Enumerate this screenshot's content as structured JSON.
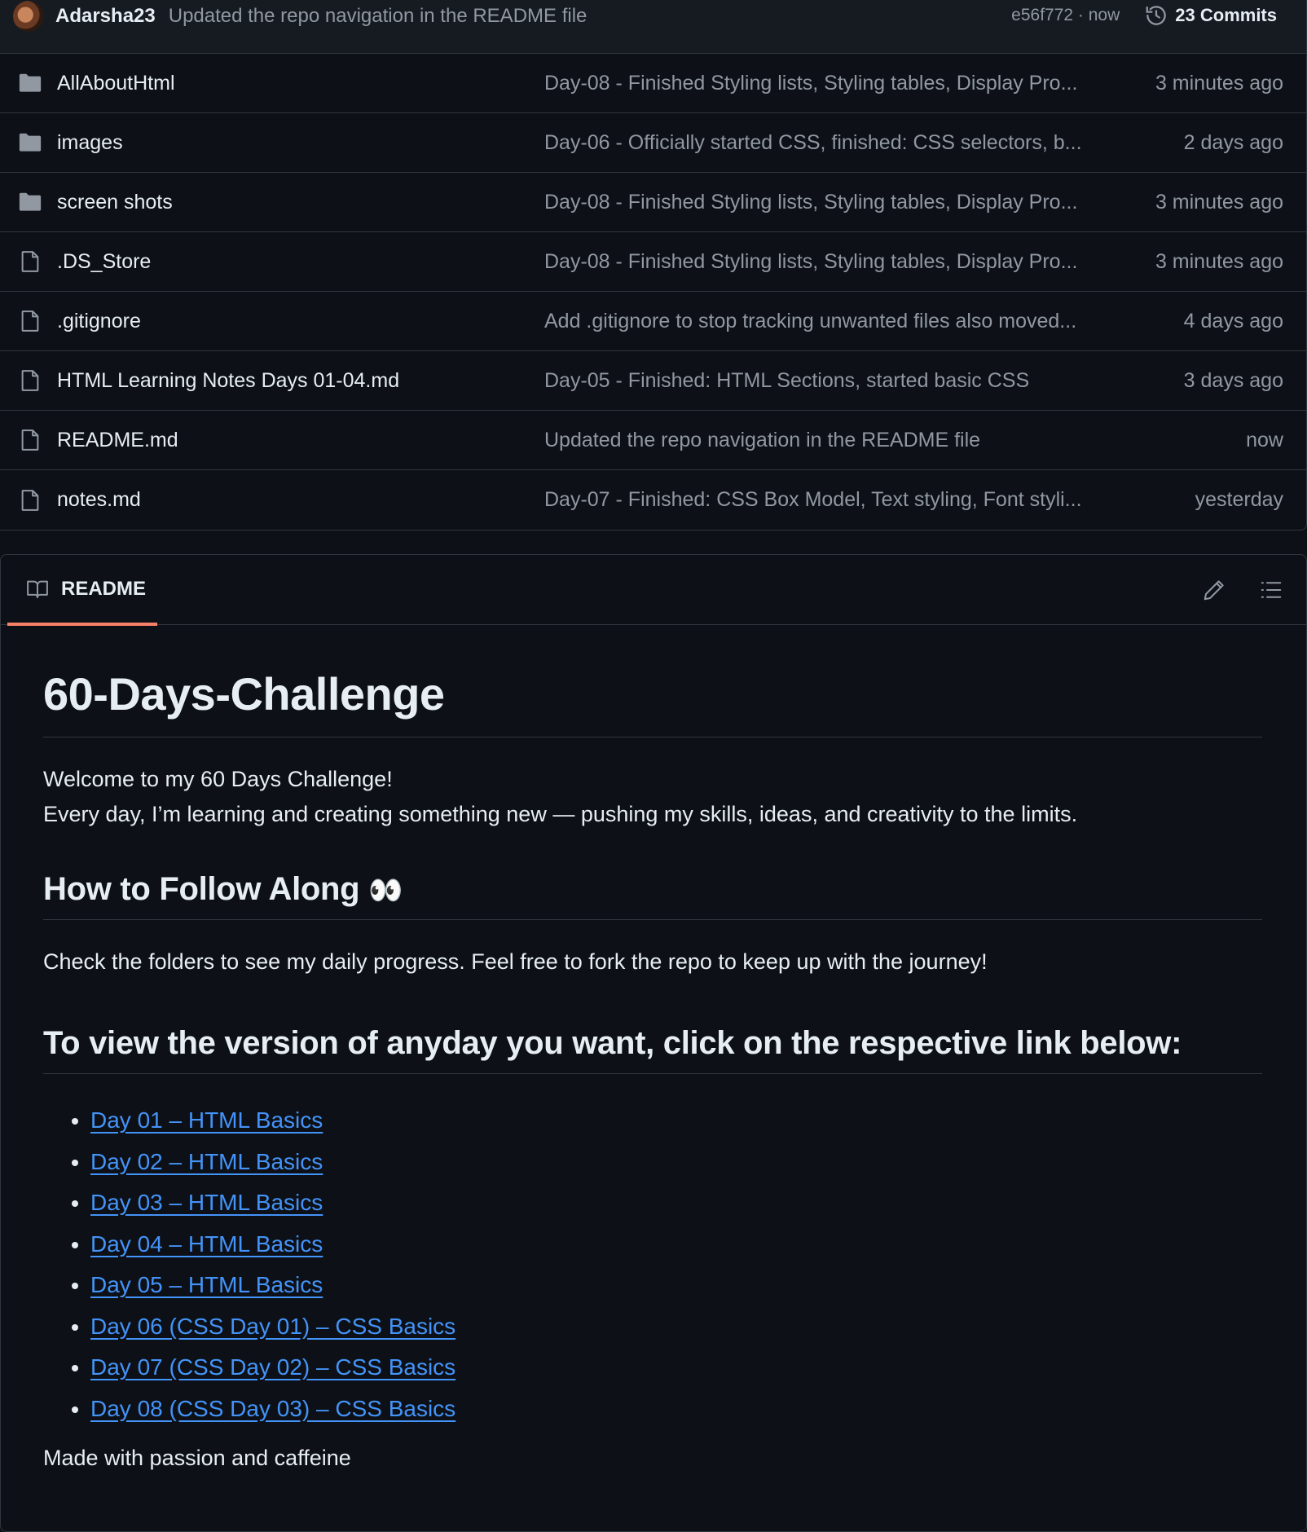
{
  "commit": {
    "author": "Adarsha23",
    "message": "Updated the repo navigation in the README file",
    "hash_time": "e56f772 · now",
    "commits_label": "23 Commits"
  },
  "files": [
    {
      "type": "folder",
      "name": "AllAboutHtml",
      "message": "Day-08 - Finished Styling lists, Styling tables, Display Pro...",
      "time": "3 minutes ago"
    },
    {
      "type": "folder",
      "name": "images",
      "message": "Day-06 - Officially started CSS, finished: CSS selectors, b...",
      "time": "2 days ago"
    },
    {
      "type": "folder",
      "name": "screen shots",
      "message": "Day-08 - Finished Styling lists, Styling tables, Display Pro...",
      "time": "3 minutes ago"
    },
    {
      "type": "file",
      "name": ".DS_Store",
      "message": "Day-08 - Finished Styling lists, Styling tables, Display Pro...",
      "time": "3 minutes ago"
    },
    {
      "type": "file",
      "name": ".gitignore",
      "message": "Add .gitignore to stop tracking unwanted files also moved...",
      "time": "4 days ago"
    },
    {
      "type": "file",
      "name": "HTML Learning Notes Days 01-04.md",
      "message": "Day-05 - Finished: HTML Sections, started basic CSS",
      "time": "3 days ago"
    },
    {
      "type": "file",
      "name": "README.md",
      "message": "Updated the repo navigation in the README file",
      "time": "now"
    },
    {
      "type": "file",
      "name": "notes.md",
      "message": "Day-07 - Finished: CSS Box Model, Text styling, Font styli...",
      "time": "yesterday"
    }
  ],
  "readme": {
    "tab_label": "README",
    "title": "60-Days-Challenge",
    "intro_line1": "Welcome to my 60 Days Challenge!",
    "intro_line2": "Every day, I’m learning and creating something new — pushing my skills, ideas, and creativity to the limits.",
    "follow_heading": "How to Follow Along",
    "follow_emoji": "👀",
    "follow_text": "Check the folders to see my daily progress. Feel free to fork the repo to keep up with the journey!",
    "links_heading": "To view the version of anyday you want, click on the respective link below:",
    "links": [
      "Day 01 – HTML Basics",
      "Day 02 – HTML Basics",
      "Day 03 – HTML Basics",
      "Day 04 – HTML Basics",
      "Day 05 – HTML Basics",
      "Day 06 (CSS Day 01) – CSS Basics",
      "Day 07 (CSS Day 02) – CSS Basics",
      "Day 08 (CSS Day 03) – CSS Basics"
    ],
    "footer": "Made with passion and caffeine"
  },
  "colors": {
    "background": "#0d1117",
    "border": "#30363d",
    "link": "#4493f8",
    "tab_underline": "#f78166",
    "muted_text": "#9198a1"
  }
}
